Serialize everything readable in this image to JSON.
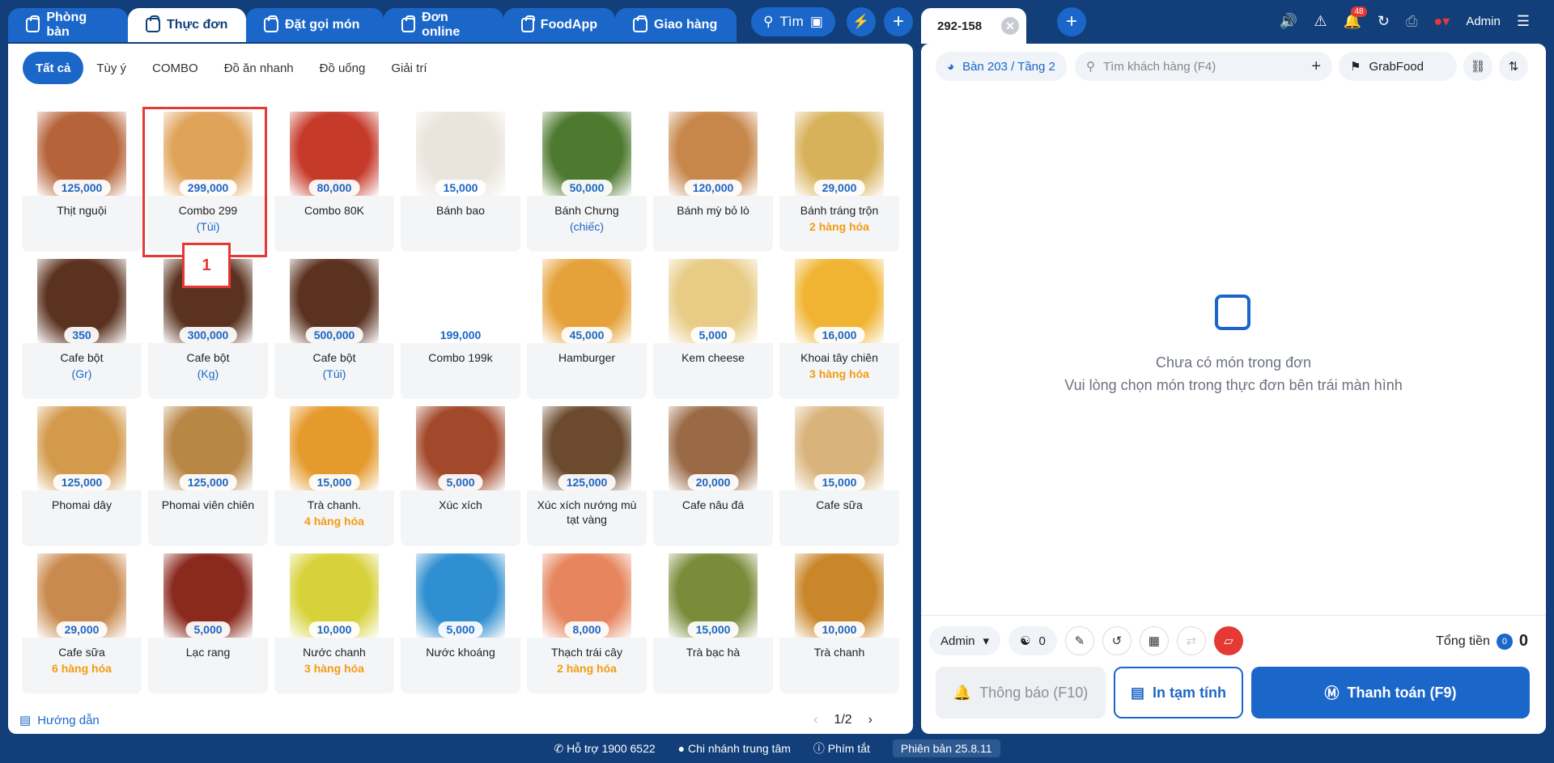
{
  "top_tabs": [
    {
      "label": "Phòng bàn",
      "active": false
    },
    {
      "label": "Thực đơn",
      "active": true
    },
    {
      "label": "Đặt gọi món",
      "active": false
    },
    {
      "label": "Đơn online",
      "active": false
    },
    {
      "label": "FoodApp",
      "active": false
    },
    {
      "label": "Giao hàng",
      "active": false
    }
  ],
  "search_label": "Tìm",
  "categories": [
    "Tất cả",
    "Tùy ý",
    "COMBO",
    "Đồ ăn nhanh",
    "Đồ uống",
    "Giải trí"
  ],
  "items": [
    {
      "name": "Thịt nguội",
      "price": "125,000",
      "sub": "",
      "sub_style": "",
      "icon": "cold-cuts-photo",
      "color": "#b5633a"
    },
    {
      "name": "Combo 299",
      "price": "299,000",
      "sub": "(Túi)",
      "sub_style": "blue",
      "icon": "combo-photo",
      "color": "#e0a35a"
    },
    {
      "name": "Combo 80K",
      "price": "80,000",
      "sub": "",
      "sub_style": "",
      "icon": "burger-fries-photo",
      "color": "#c63a2a"
    },
    {
      "name": "Bánh bao",
      "price": "15,000",
      "sub": "",
      "sub_style": "",
      "icon": "steamed-bun-photo",
      "color": "#e9e4dc"
    },
    {
      "name": "Bánh Chưng",
      "price": "50,000",
      "sub": "(chiếc)",
      "sub_style": "blue",
      "icon": "banh-chung-photo",
      "color": "#4e7a2f"
    },
    {
      "name": "Bánh mỳ bỏ lò",
      "price": "120,000",
      "sub": "",
      "sub_style": "",
      "icon": "baked-bread-photo",
      "color": "#c7874b"
    },
    {
      "name": "Bánh tráng trộn",
      "price": "29,000",
      "sub": "2 hàng hóa",
      "sub_style": "orange",
      "icon": "rice-paper-salad-photo",
      "color": "#d8b25a"
    },
    {
      "name": "Cafe bột",
      "price": "350",
      "sub": "(Gr)",
      "sub_style": "blue",
      "icon": "coffee-powder-photo",
      "color": "#5b3220"
    },
    {
      "name": "Cafe bột",
      "price": "300,000",
      "sub": "(Kg)",
      "sub_style": "blue",
      "icon": "coffee-powder-photo",
      "color": "#5b3220"
    },
    {
      "name": "Cafe bột",
      "price": "500,000",
      "sub": "(Túi)",
      "sub_style": "blue",
      "icon": "coffee-powder-photo",
      "color": "#5b3220"
    },
    {
      "name": "Combo 199k",
      "price": "199,000",
      "sub": "",
      "sub_style": "",
      "icon": "combo-199k-banner",
      "color": "#ffffff"
    },
    {
      "name": "Hamburger",
      "price": "45,000",
      "sub": "",
      "sub_style": "",
      "icon": "hamburger-photo",
      "color": "#e6a23a"
    },
    {
      "name": "Kem cheese",
      "price": "5,000",
      "sub": "",
      "sub_style": "",
      "icon": "cheese-photo",
      "color": "#e8cc86"
    },
    {
      "name": "Khoai tây chiên",
      "price": "16,000",
      "sub": "3 hàng hóa",
      "sub_style": "orange",
      "icon": "french-fries-photo",
      "color": "#f0b432"
    },
    {
      "name": "Phomai dây",
      "price": "125,000",
      "sub": "",
      "sub_style": "",
      "icon": "string-cheese-photo",
      "color": "#d39a4c"
    },
    {
      "name": "Phomai viên chiên",
      "price": "125,000",
      "sub": "",
      "sub_style": "",
      "icon": "fried-cheese-balls-photo",
      "color": "#b88645"
    },
    {
      "name": "Trà chanh.",
      "price": "15,000",
      "sub": "4 hàng hóa",
      "sub_style": "orange",
      "icon": "lemon-tea-photo",
      "color": "#e59a2c"
    },
    {
      "name": "Xúc xích",
      "price": "5,000",
      "sub": "",
      "sub_style": "",
      "icon": "sausage-photo",
      "color": "#a2492b"
    },
    {
      "name": "Xúc xích nướng mù tạt vàng",
      "price": "125,000",
      "sub": "",
      "sub_style": "",
      "icon": "grilled-sausage-photo",
      "color": "#6b4a2e"
    },
    {
      "name": "Cafe nâu đá",
      "price": "20,000",
      "sub": "",
      "sub_style": "",
      "icon": "iced-coffee-photo",
      "color": "#9a6a46"
    },
    {
      "name": "Cafe sữa",
      "price": "15,000",
      "sub": "",
      "sub_style": "",
      "icon": "milk-coffee-cup-photo",
      "color": "#d8b37b"
    },
    {
      "name": "Cafe sữa",
      "price": "29,000",
      "sub": "6 hàng hóa",
      "sub_style": "orange",
      "icon": "cafe-sua-menu-photo",
      "color": "#c98a4f"
    },
    {
      "name": "Lạc rang",
      "price": "5,000",
      "sub": "",
      "sub_style": "",
      "icon": "roasted-peanuts-photo",
      "color": "#8a2a1e"
    },
    {
      "name": "Nước chanh",
      "price": "10,000",
      "sub": "3 hàng hóa",
      "sub_style": "orange",
      "icon": "lemonade-photo",
      "color": "#d7d23a"
    },
    {
      "name": "Nước khoáng",
      "price": "5,000",
      "sub": "",
      "sub_style": "",
      "icon": "mineral-water-photo",
      "color": "#2f8fd0"
    },
    {
      "name": "Thạch trái cây",
      "price": "8,000",
      "sub": "2 hàng hóa",
      "sub_style": "orange",
      "icon": "fruit-jelly-photo",
      "color": "#e6855e"
    },
    {
      "name": "Trà bạc hà",
      "price": "15,000",
      "sub": "",
      "sub_style": "",
      "icon": "mint-tea-photo",
      "color": "#7a8b3a"
    },
    {
      "name": "Trà chanh",
      "price": "10,000",
      "sub": "",
      "sub_style": "",
      "icon": "iced-lemon-tea-photo",
      "color": "#c9862a"
    }
  ],
  "highlight_label": "1",
  "guide_label": "Hướng dẫn",
  "pager": {
    "current": "1/2"
  },
  "order": {
    "id": "292-158",
    "table": "Bàn 203 / Tầng 2",
    "customer_placeholder": "Tìm khách hàng (F4)",
    "channel": "GrabFood",
    "empty_title": "Chưa có món trong đơn",
    "empty_sub": "Vui lòng chọn món trong thực đơn bên trái màn hình",
    "staff": "Admin",
    "guest_count": "0",
    "total_label": "Tổng tiền",
    "total_badge": "0",
    "total_value": "0",
    "btn_notify": "Thông báo (F10)",
    "btn_print": "In tạm tính",
    "btn_pay": "Thanh toán (F9)"
  },
  "header": {
    "notif_count": "48",
    "user": "Admin"
  },
  "footer": {
    "support": "Hỗ trợ 1900 6522",
    "branch": "Chi nhánh trung tâm",
    "shortcuts": "Phím tắt",
    "version": "Phiên bản 25.8.11"
  }
}
